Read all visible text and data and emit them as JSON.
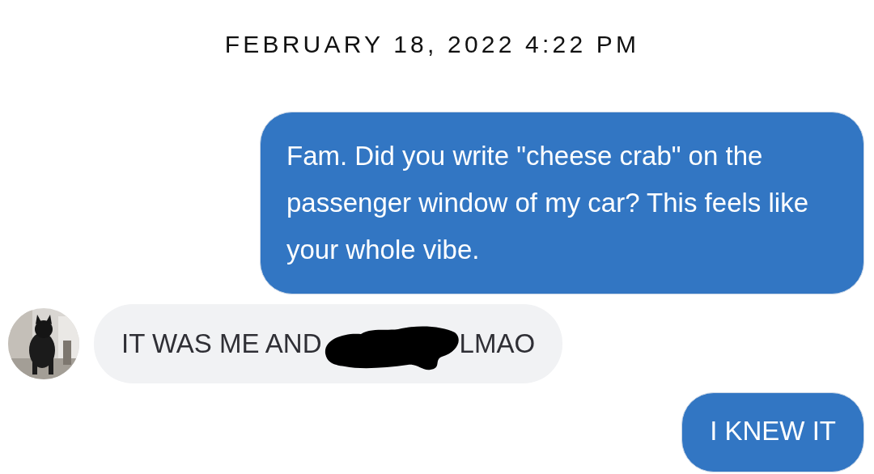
{
  "timestamp": "FEBRUARY 18, 2022 4:22 PM",
  "messages": [
    {
      "kind": "outgoing",
      "text": "Fam. Did you write \"cheese crab\" on the passenger window of my car? This feels like your whole vibe."
    },
    {
      "kind": "incoming",
      "text_before": "IT WAS ME AND",
      "redacted": true,
      "text_after": "LMAO"
    },
    {
      "kind": "outgoing",
      "text": "I KNEW IT"
    }
  ]
}
